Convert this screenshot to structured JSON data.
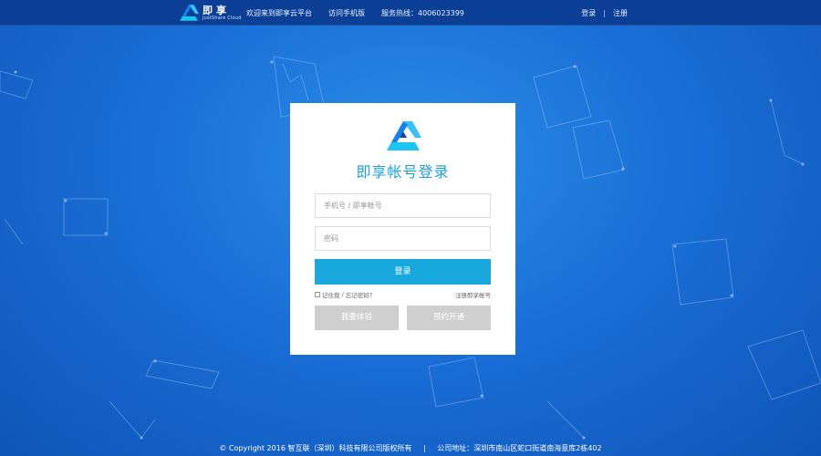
{
  "header": {
    "brand_name": "即享",
    "brand_sub": "JustShare Cloud",
    "links": [
      "欢迎来到即享云平台",
      "访问手机版",
      "服务热线：4006023399"
    ],
    "login_label": "登录",
    "separator": "|",
    "register_label": "注册"
  },
  "login_card": {
    "title": "即享帐号登录",
    "account_placeholder": "手机号 / 即享帐号",
    "password_placeholder": "密码",
    "submit_label": "登录",
    "remember_label": "记住我",
    "forgot_label": "忘记密码？",
    "remember_separator": " / ",
    "register_account_label": "注册即享帐号",
    "trial_label": "我要体验",
    "reserve_label": "预约开通"
  },
  "footer": {
    "copyright": "© Copyright 2016 智互联（深圳）科技有限公司版权所有",
    "separator": "|",
    "address": "公司地址：深圳市南山区蛇口街道南海意库2栋402"
  },
  "colors": {
    "accent": "#19a8de",
    "title": "#1aa2d8",
    "topbar": "#0b3f95",
    "background": "#1a6fd6",
    "disabled_button": "#cfcfcf"
  }
}
